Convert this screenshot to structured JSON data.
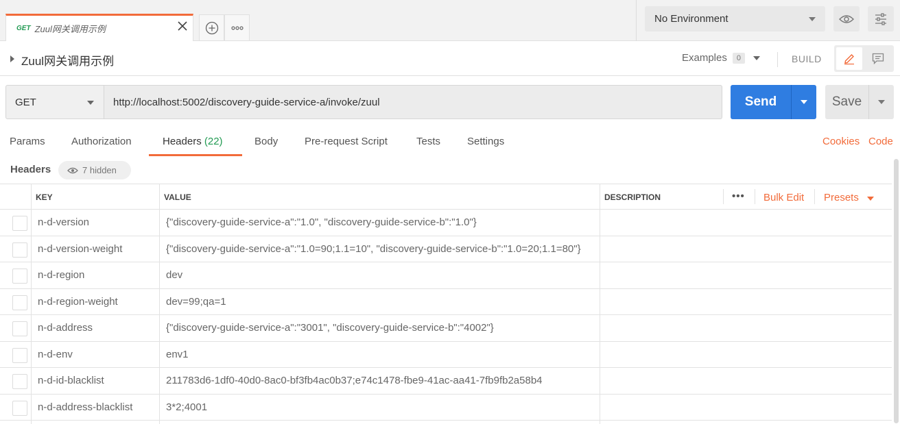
{
  "tab": {
    "method": "GET",
    "name": "Zuul网关调用示例"
  },
  "environment": {
    "selected": "No Environment"
  },
  "request": {
    "title": "Zuul网关调用示例",
    "examples_label": "Examples",
    "examples_count": "0",
    "build_label": "BUILD",
    "method": "GET",
    "url": "http://localhost:5002/discovery-guide-service-a/invoke/zuul",
    "send_label": "Send",
    "save_label": "Save"
  },
  "tabs": {
    "params": "Params",
    "authorization": "Authorization",
    "headers": "Headers",
    "headers_count": "(22)",
    "body": "Body",
    "prerequest": "Pre-request Script",
    "tests": "Tests",
    "settings": "Settings",
    "cookies": "Cookies",
    "code": "Code"
  },
  "headers_section": {
    "label": "Headers",
    "hidden": "7 hidden"
  },
  "table": {
    "columns": {
      "key": "KEY",
      "value": "VALUE",
      "description": "DESCRIPTION"
    },
    "bulk_edit": "Bulk Edit",
    "presets": "Presets",
    "rows": [
      {
        "key": "n-d-version",
        "value": "{\"discovery-guide-service-a\":\"1.0\", \"discovery-guide-service-b\":\"1.0\"}"
      },
      {
        "key": "n-d-version-weight",
        "value": "{\"discovery-guide-service-a\":\"1.0=90;1.1=10\", \"discovery-guide-service-b\":\"1.0=20;1.1=80\"}"
      },
      {
        "key": "n-d-region",
        "value": "dev"
      },
      {
        "key": "n-d-region-weight",
        "value": "dev=99;qa=1"
      },
      {
        "key": "n-d-address",
        "value": "{\"discovery-guide-service-a\":\"3001\", \"discovery-guide-service-b\":\"4002\"}"
      },
      {
        "key": "n-d-env",
        "value": "env1"
      },
      {
        "key": "n-d-id-blacklist",
        "value": "211783d6-1df0-40d0-8ac0-bf3fb4ac0b37;e74c1478-fbe9-41ac-aa41-7fb9fb2a58b4"
      },
      {
        "key": "n-d-address-blacklist",
        "value": "3*2;4001"
      }
    ]
  },
  "colors": {
    "accent": "#f26b3a",
    "send": "#2f7de1",
    "method_get": "#219a52"
  }
}
